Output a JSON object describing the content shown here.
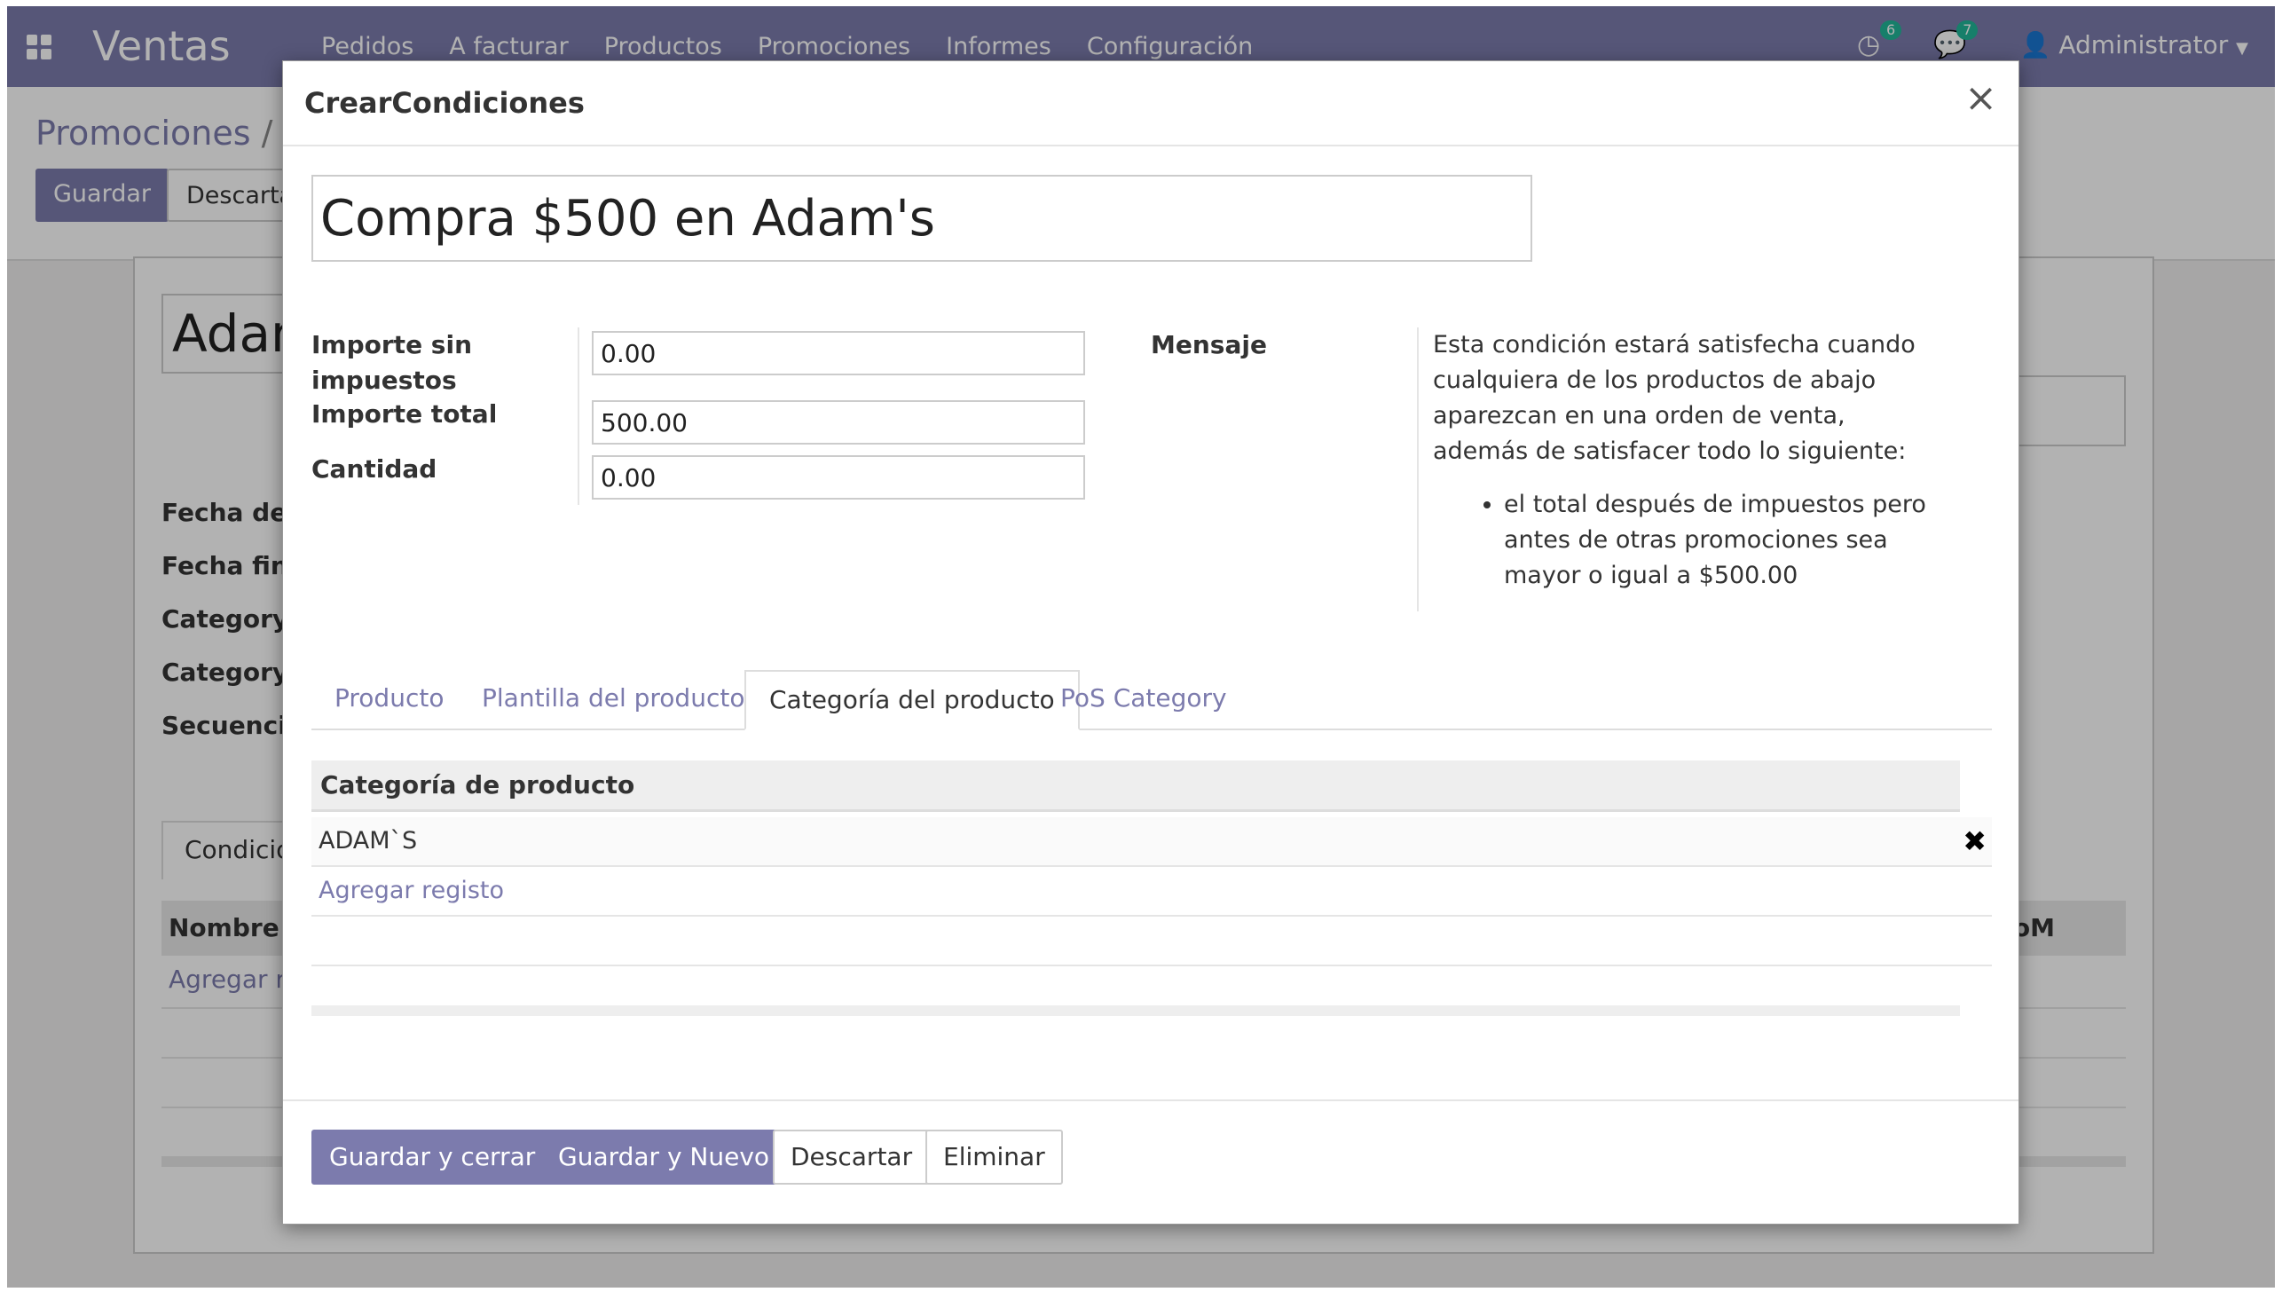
{
  "navbar": {
    "app_name": "Ventas",
    "menu": [
      "Pedidos",
      "A facturar",
      "Productos",
      "Promociones",
      "Informes",
      "Configuración"
    ],
    "activities_count": "6",
    "messages_count": "7",
    "user": "Administrator"
  },
  "background": {
    "breadcrumb": "Promociones",
    "save_button": "Guardar",
    "discard_button": "Descartar",
    "record_title": "Adam",
    "labels": [
      "Fecha de",
      "Fecha fina",
      "Category",
      "Category",
      "Secuencia"
    ],
    "tab_label": "Condicio",
    "col_name": "Nombre",
    "col_uom": "oM",
    "add_line": "Agregar r"
  },
  "modal": {
    "title": "CrearCondiciones",
    "name_value": "Compra $500 en Adam's",
    "fields": {
      "untaxed_label": "Importe sin impuestos",
      "untaxed_value": "0.00",
      "total_label": "Importe total",
      "total_value": "500.00",
      "qty_label": "Cantidad",
      "qty_value": "0.00",
      "message_label": "Mensaje"
    },
    "message": {
      "intro": "Esta condición estará satisfecha cuando cualquiera de los productos de abajo aparezcan en una orden de venta, además de satisfacer todo lo siguiente:",
      "bullet": "el total después de impuestos pero antes de otras promociones sea mayor o igual a $500.00"
    },
    "tabs": [
      "Producto",
      "Plantilla del producto",
      "Categoría del producto",
      "PoS Category"
    ],
    "active_tab": "Categoría del producto",
    "table": {
      "header": "Categoría de producto",
      "rows": [
        "ADAM`S"
      ],
      "add_line": "Agregar registo"
    },
    "buttons": {
      "save_close": "Guardar y cerrar",
      "save_new": "Guardar y Nuevo",
      "discard": "Descartar",
      "delete": "Eliminar"
    }
  }
}
